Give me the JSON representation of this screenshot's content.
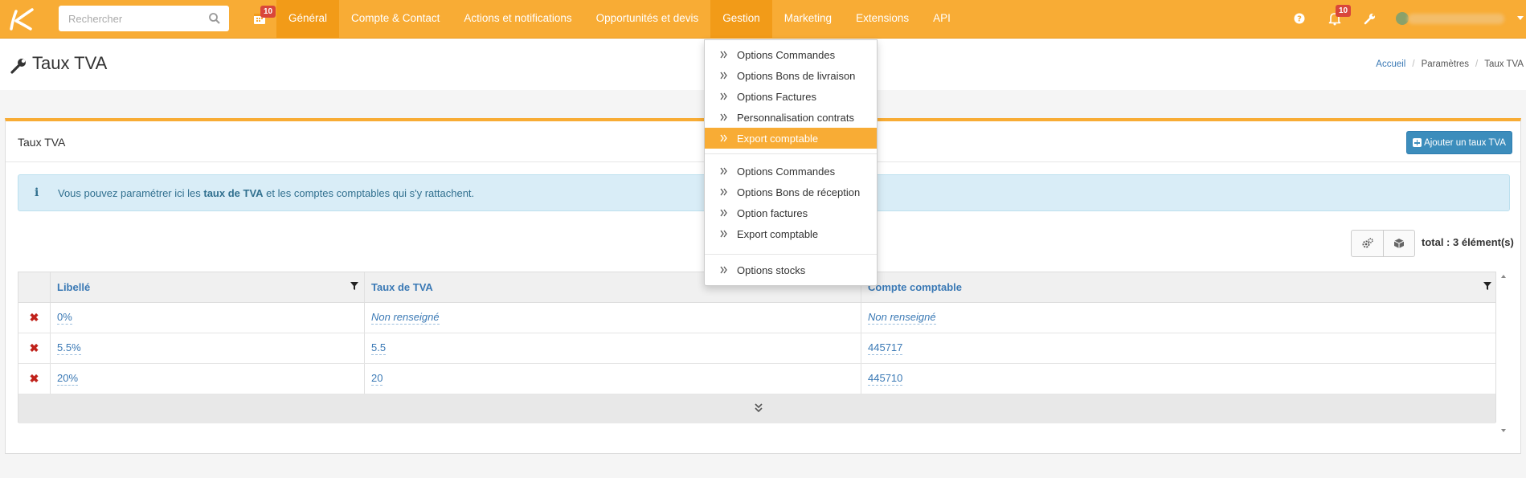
{
  "topbar": {
    "search_placeholder": "Rechercher",
    "calendar_badge": "10",
    "notifications_badge": "10",
    "nav": [
      "Général",
      "Compte & Contact",
      "Actions et notifications",
      "Opportunités et devis",
      "Gestion",
      "Marketing",
      "Extensions",
      "API"
    ],
    "active_nav": "Général",
    "open_nav": "Gestion"
  },
  "page": {
    "title": "Taux TVA",
    "breadcrumb": [
      "Accueil",
      "Paramètres",
      "Taux TVA"
    ]
  },
  "panel": {
    "title": "Taux TVA",
    "add_button": "Ajouter un taux TVA",
    "info_prefix": "Vous pouvez paramétrer ici les ",
    "info_bold": "taux de TVA",
    "info_suffix": " et les comptes comptables qui s'y rattachent.",
    "total_label": "total : 3 élément(s)"
  },
  "table": {
    "columns": [
      "Libellé",
      "Taux de TVA",
      "Compte comptable"
    ],
    "rows": [
      {
        "libelle": "0%",
        "taux": "Non renseigné",
        "compte": "Non renseigné"
      },
      {
        "libelle": "5.5%",
        "taux": "5.5",
        "compte": "445717"
      },
      {
        "libelle": "20%",
        "taux": "20",
        "compte": "445710"
      }
    ]
  },
  "dropdown": {
    "group1": [
      "Options Commandes",
      "Options Bons de livraison",
      "Options Factures",
      "Personnalisation contrats",
      "Export comptable"
    ],
    "group2": [
      "Options Commandes",
      "Options Bons de réception",
      "Option factures",
      "Export comptable"
    ],
    "group3": [
      "Options stocks"
    ],
    "highlighted": "Export comptable"
  },
  "colors": {
    "brand": "#f8ac35",
    "link": "#3a79b5",
    "primary_button": "#3c8dbc",
    "info_bg": "#d9edf7",
    "delete": "#c0221b"
  }
}
